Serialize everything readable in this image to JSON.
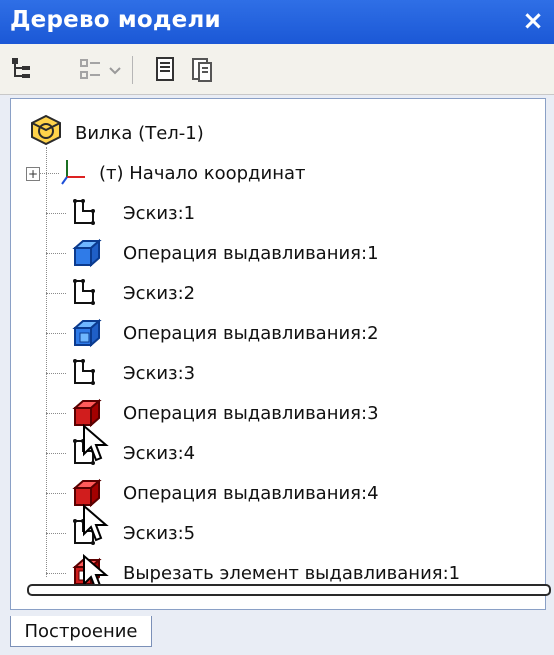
{
  "window": {
    "title": "Дерево модели",
    "close_icon": "close-icon"
  },
  "toolbar": {
    "icons": [
      "tree-structure-icon",
      "filter-tree-icon",
      "dropdown-chevron-icon",
      "properties-doc-icon",
      "doc-edit-icon"
    ]
  },
  "tree": {
    "root_label": "Вилка (Тел-1)",
    "items": [
      {
        "label": "(т) Начало координат",
        "icon": "axes-origin-icon",
        "expand": "+"
      },
      {
        "label": "Эскиз:1",
        "icon": "sketch-icon"
      },
      {
        "label": "Операция выдавливания:1",
        "icon": "extrude-blue-icon"
      },
      {
        "label": "Эскиз:2",
        "icon": "sketch-icon"
      },
      {
        "label": "Операция выдавливания:2",
        "icon": "extrude-blue-icon"
      },
      {
        "label": "Эскиз:3",
        "icon": "sketch-icon"
      },
      {
        "label": "Операция выдавливания:3",
        "icon": "extrude-red-icon"
      },
      {
        "label": "Эскиз:4",
        "icon": "sketch-icon"
      },
      {
        "label": "Операция выдавливания:4",
        "icon": "extrude-red-icon"
      },
      {
        "label": "Эскиз:5",
        "icon": "sketch-icon"
      },
      {
        "label": "Вырезать элемент выдавливания:1",
        "icon": "cut-extrude-red-icon"
      }
    ]
  },
  "tabs": [
    {
      "label": "Построение",
      "selected": true
    }
  ],
  "colors": {
    "title_blue": "#1b58d6",
    "extrude_blue": "#2f7be8",
    "extrude_red": "#d11d1d"
  }
}
